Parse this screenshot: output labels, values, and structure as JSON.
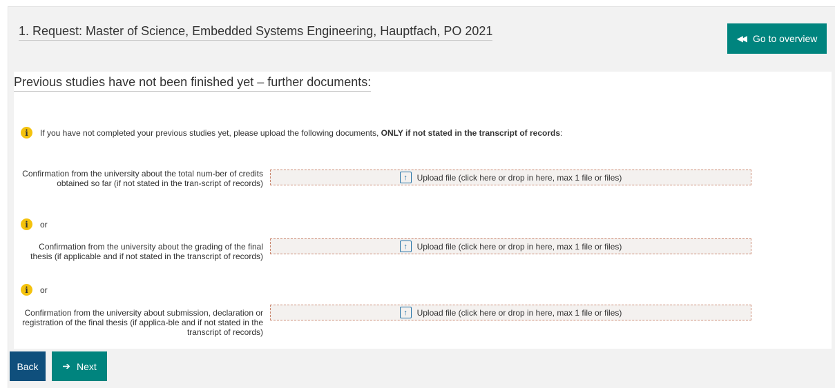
{
  "header": {
    "request_title": "1. Request: Master of Science, Embedded Systems Engineering, Hauptfach, PO 2021",
    "overview_button": "Go to overview",
    "overview_icon": "double-chevron-left-icon"
  },
  "section": {
    "title": "Previous studies have not been finished yet – further documents:",
    "hint_prefix": "If you have not completed your previous studies yet, please upload the following documents,",
    "hint_bold": "ONLY if not stated in the transcript of records",
    "hint_suffix": ":",
    "or_label": "or"
  },
  "documents": [
    {
      "label": "Confirmation from the university about the total num-ber of credits obtained so far (if not stated in the tran-script of records)",
      "upload_label": "Upload file (click here or drop in here, max 1 file or files)"
    },
    {
      "label": "Confirmation from the university about the grading of the final thesis (if applicable and if not stated in the transcript of records)",
      "upload_label": "Upload file (click here or drop in here, max 1 file or files)"
    },
    {
      "label": "Confirmation from the university about submission, declaration or registration of the final thesis (if applica-ble and if not stated in the transcript of records)",
      "upload_label": "Upload file (click here or drop in here, max 1 file or files)"
    }
  ],
  "footer": {
    "back_label": "Back",
    "next_label": "Next",
    "next_icon": "arrow-right-icon"
  },
  "colors": {
    "primary_teal": "#00847e",
    "back_blue": "#0f4f7c",
    "info_yellow": "#f4c20d",
    "upload_border": "#c9866e"
  }
}
